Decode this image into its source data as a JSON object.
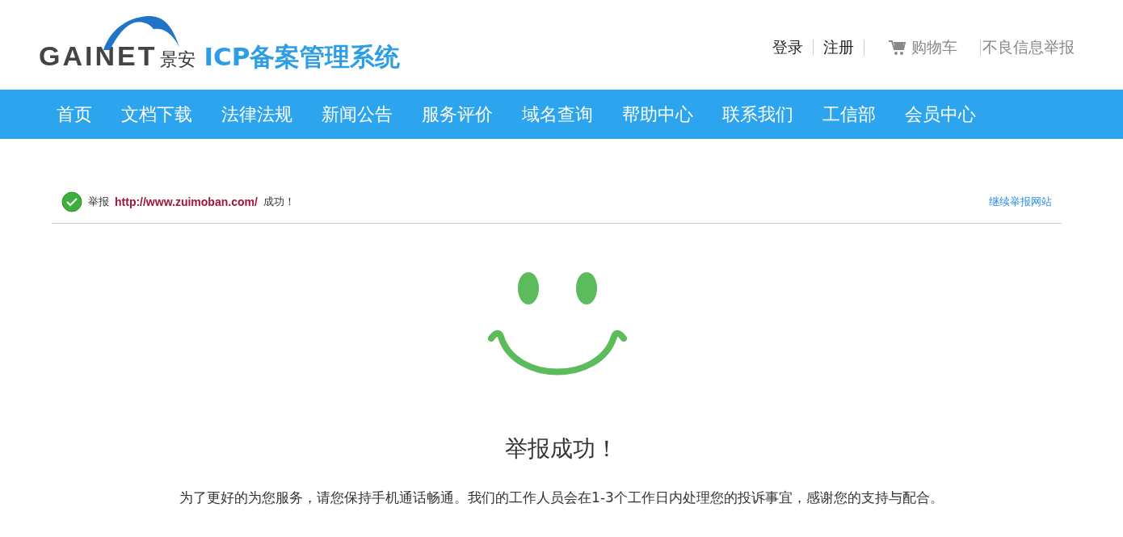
{
  "logo": {
    "brand": "GAINET",
    "brand_cn": "景安",
    "system_title": "ICP备案管理系统"
  },
  "top_links": [
    {
      "label": "登录",
      "kind": "plain"
    },
    {
      "label": "注册",
      "kind": "plain"
    },
    {
      "label": "购物车",
      "kind": "cart"
    },
    {
      "label": "不良信息举报",
      "kind": "muted"
    }
  ],
  "nav": [
    "首页",
    "文档下载",
    "法律法规",
    "新闻公告",
    "服务评价",
    "域名查询",
    "帮助中心",
    "联系我们",
    "工信部",
    "会员中心"
  ],
  "notice": {
    "prefix": "举报",
    "url": "http://www.zuimoban.com/",
    "suffix": "成功！",
    "action": "继续举报网站"
  },
  "result": {
    "title": "举报成功！",
    "message": "为了更好的为您服务，请您保持手机通话畅通。我们的工作人员会在1-3个工作日内处理您的投诉事宜，感谢您的支持与配合。"
  }
}
